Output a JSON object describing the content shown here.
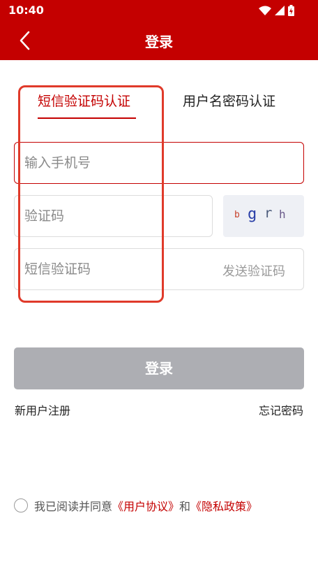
{
  "status_bar": {
    "time": "10:40"
  },
  "nav": {
    "title": "登录",
    "back_icon": "chevron-left-icon"
  },
  "tabs": [
    {
      "label": "短信验证码认证",
      "active": true
    },
    {
      "label": "用户名密码认证",
      "active": false
    }
  ],
  "form": {
    "phone_placeholder": "输入手机号",
    "captcha_placeholder": "验证码",
    "captcha_chars": [
      "b",
      "g",
      "r",
      "h"
    ],
    "sms_placeholder": "短信验证码",
    "send_code_label": "发送验证码"
  },
  "login_button": "登录",
  "links": {
    "register": "新用户注册",
    "forgot_password": "忘记密码"
  },
  "agreement": {
    "prefix": "我已阅读并同意",
    "user_agreement": "《用户协议》",
    "conjunction": "和",
    "privacy_policy": "《隐私政策》"
  },
  "colors": {
    "brand": "#c40000",
    "button_disabled": "#adaeb3",
    "annotation": "#e03a2a"
  }
}
